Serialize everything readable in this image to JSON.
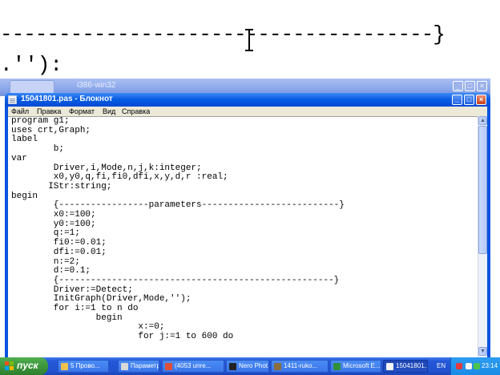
{
  "background": {
    "zoom_line1": "-------------------------------------}",
    "zoom_line2": ".''):",
    "title": "i386-win32"
  },
  "window": {
    "title": "15041801.pas - Блокнот",
    "controls": {
      "minimize": "_",
      "maximize": "□",
      "close": "×"
    }
  },
  "menu": {
    "items": [
      "Файл",
      "Правка",
      "Формат",
      "Вид",
      "Справка"
    ]
  },
  "editor": {
    "lines": [
      "program g1;",
      "uses crt,Graph;",
      "label",
      "        b;",
      "var",
      "        Driver,i,Mode,n,j,k:integer;",
      "        x0,y0,q,fi,fi0,dfi,x,y,d,r :real;",
      "       IStr:string;",
      "begin",
      "        {-----------------parameters--------------------------}",
      "        x0:=100;",
      "        y0:=100;",
      "        q:=1;",
      "        fi0:=0.01;",
      "        dfi:=0.01;",
      "        n:=2;",
      "        d:=0.1;",
      "        {----------------------------------------------------}",
      "        Driver:=Detect;",
      "        InitGraph(Driver,Mode,'');",
      "        for i:=1 to n do",
      "                begin",
      "                        x:=0;",
      "                        for j:=1 to 600 do"
    ]
  },
  "taskbar": {
    "start_label": "пуск",
    "tasks": [
      {
        "label": "5 Прово...",
        "icon_color": "#f2c14e"
      },
      {
        "label": "Параметр...",
        "icon_color": "#d9d9d9"
      },
      {
        "label": "(4053 unre...",
        "icon_color": "#e04f3a"
      },
      {
        "label": "Nero Phot...",
        "icon_color": "#222222"
      },
      {
        "label": "1411-ruko...",
        "icon_color": "#8a6d3b"
      },
      {
        "label": "Microsoft E...",
        "icon_color": "#2f8f3a"
      },
      {
        "label": "15041801....",
        "icon_color": "#f5f5f5"
      }
    ],
    "language": "EN",
    "clock": "23:14"
  }
}
